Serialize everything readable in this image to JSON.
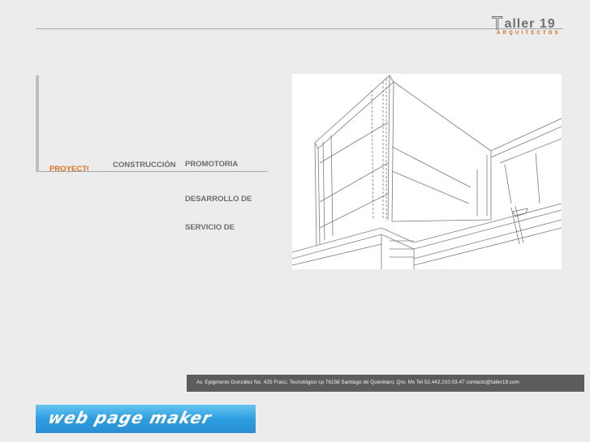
{
  "logo": {
    "initial": "T",
    "name": "aller 19",
    "subtitle": "ARQUITECTOS"
  },
  "nav": {
    "items": [
      {
        "label": "PROYECTOS"
      },
      {
        "label": "CONSTRUCCIÓN"
      },
      {
        "label": "PROMOTORIA"
      },
      {
        "label": "DESARROLLO DE"
      },
      {
        "label": "SERVICIO DE"
      }
    ]
  },
  "footer": {
    "address": "Av. Epigmenio González No. 425 Fracc. Tecnológico cp 76158   Santiago de Querétaro, Qro. Mx   Tel 52.442.210.03.47   contacto@taller19.com"
  },
  "badge": {
    "text": "web page maker"
  },
  "colors": {
    "accent": "#e07020",
    "footer_bg": "#5c5c5c",
    "badge_blue": "#2d9de0"
  }
}
